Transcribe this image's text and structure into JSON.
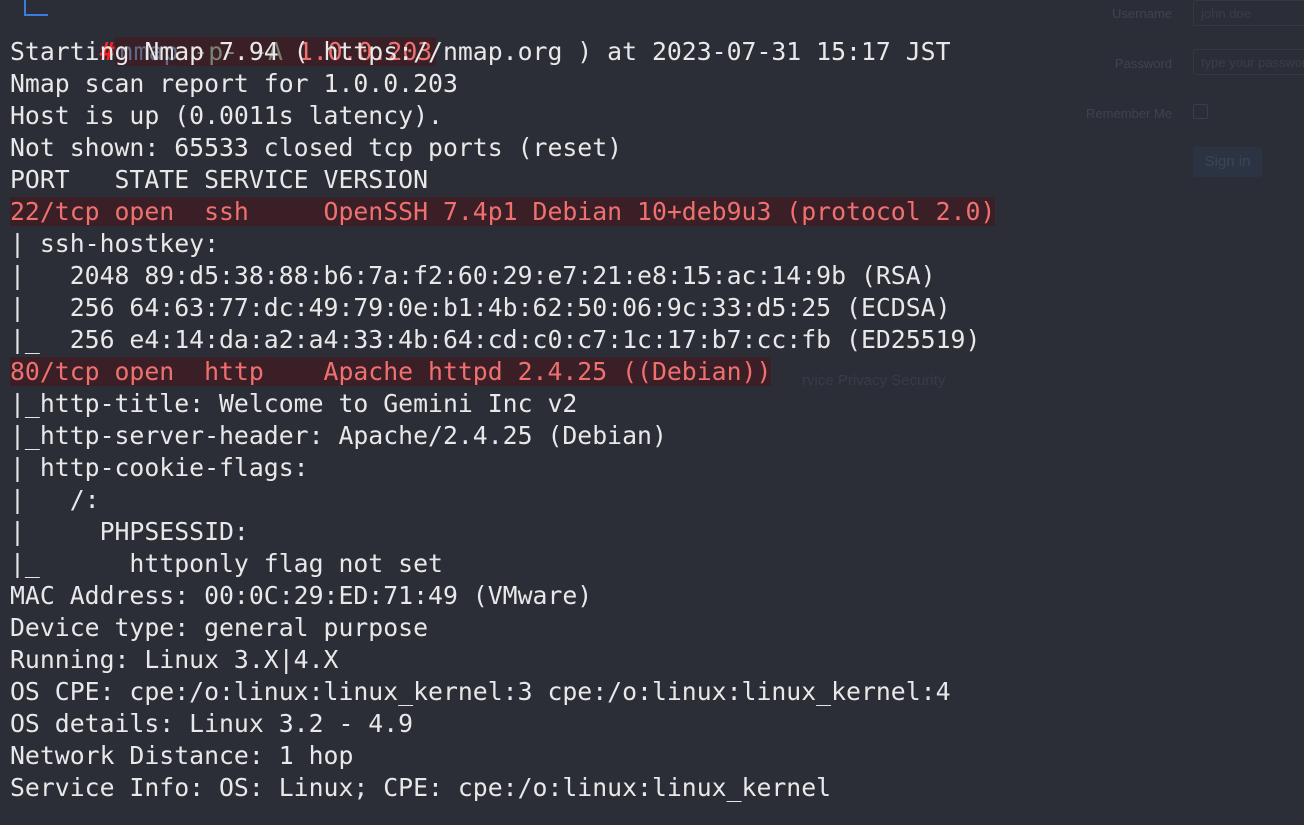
{
  "background_form": {
    "username_label": "Username",
    "username_placeholder": "john.doe",
    "password_label": "Password",
    "password_placeholder": "type your password",
    "remember_label": "Remember Me",
    "signin_label": "Sign in",
    "footer_text": "rvice Privacy Security"
  },
  "prompt": {
    "symbol": "#",
    "command": "nmap",
    "args": " -p- -A ",
    "target": "1.0.0.203"
  },
  "colors": {
    "highlight_bg": "#3a2026",
    "highlight_text": "#f07070",
    "prompt_symbol": "#ff2020",
    "background": "#2b2e37"
  },
  "output": [
    {
      "text": "Starting Nmap 7.94 ( https://nmap.org ) at 2023-07-31 15:17 JST",
      "highlight": false
    },
    {
      "text": "Nmap scan report for 1.0.0.203",
      "highlight": false
    },
    {
      "text": "Host is up (0.0011s latency).",
      "highlight": false
    },
    {
      "text": "Not shown: 65533 closed tcp ports (reset)",
      "highlight": false
    },
    {
      "text": "PORT   STATE SERVICE VERSION",
      "highlight": false
    },
    {
      "text": "22/tcp open  ssh     OpenSSH 7.4p1 Debian 10+deb9u3 (protocol 2.0)",
      "highlight": true
    },
    {
      "text": "| ssh-hostkey: ",
      "highlight": false
    },
    {
      "text": "|   2048 89:d5:38:88:b6:7a:f2:60:29:e7:21:e8:15:ac:14:9b (RSA)",
      "highlight": false
    },
    {
      "text": "|   256 64:63:77:dc:49:79:0e:b1:4b:62:50:06:9c:33:d5:25 (ECDSA)",
      "highlight": false
    },
    {
      "text": "|_  256 e4:14:da:a2:a4:33:4b:64:cd:c0:c7:1c:17:b7:cc:fb (ED25519)",
      "highlight": false
    },
    {
      "text": "80/tcp open  http    Apache httpd 2.4.25 ((Debian))",
      "highlight": true
    },
    {
      "text": "|_http-title: Welcome to Gemini Inc v2",
      "highlight": false
    },
    {
      "text": "|_http-server-header: Apache/2.4.25 (Debian)",
      "highlight": false
    },
    {
      "text": "| http-cookie-flags: ",
      "highlight": false
    },
    {
      "text": "|   /: ",
      "highlight": false
    },
    {
      "text": "|     PHPSESSID: ",
      "highlight": false
    },
    {
      "text": "|_      httponly flag not set",
      "highlight": false
    },
    {
      "text": "MAC Address: 00:0C:29:ED:71:49 (VMware)",
      "highlight": false
    },
    {
      "text": "Device type: general purpose",
      "highlight": false
    },
    {
      "text": "Running: Linux 3.X|4.X",
      "highlight": false
    },
    {
      "text": "OS CPE: cpe:/o:linux:linux_kernel:3 cpe:/o:linux:linux_kernel:4",
      "highlight": false
    },
    {
      "text": "OS details: Linux 3.2 - 4.9",
      "highlight": false
    },
    {
      "text": "Network Distance: 1 hop",
      "highlight": false
    },
    {
      "text": "Service Info: OS: Linux; CPE: cpe:/o:linux:linux_kernel",
      "highlight": false
    }
  ]
}
